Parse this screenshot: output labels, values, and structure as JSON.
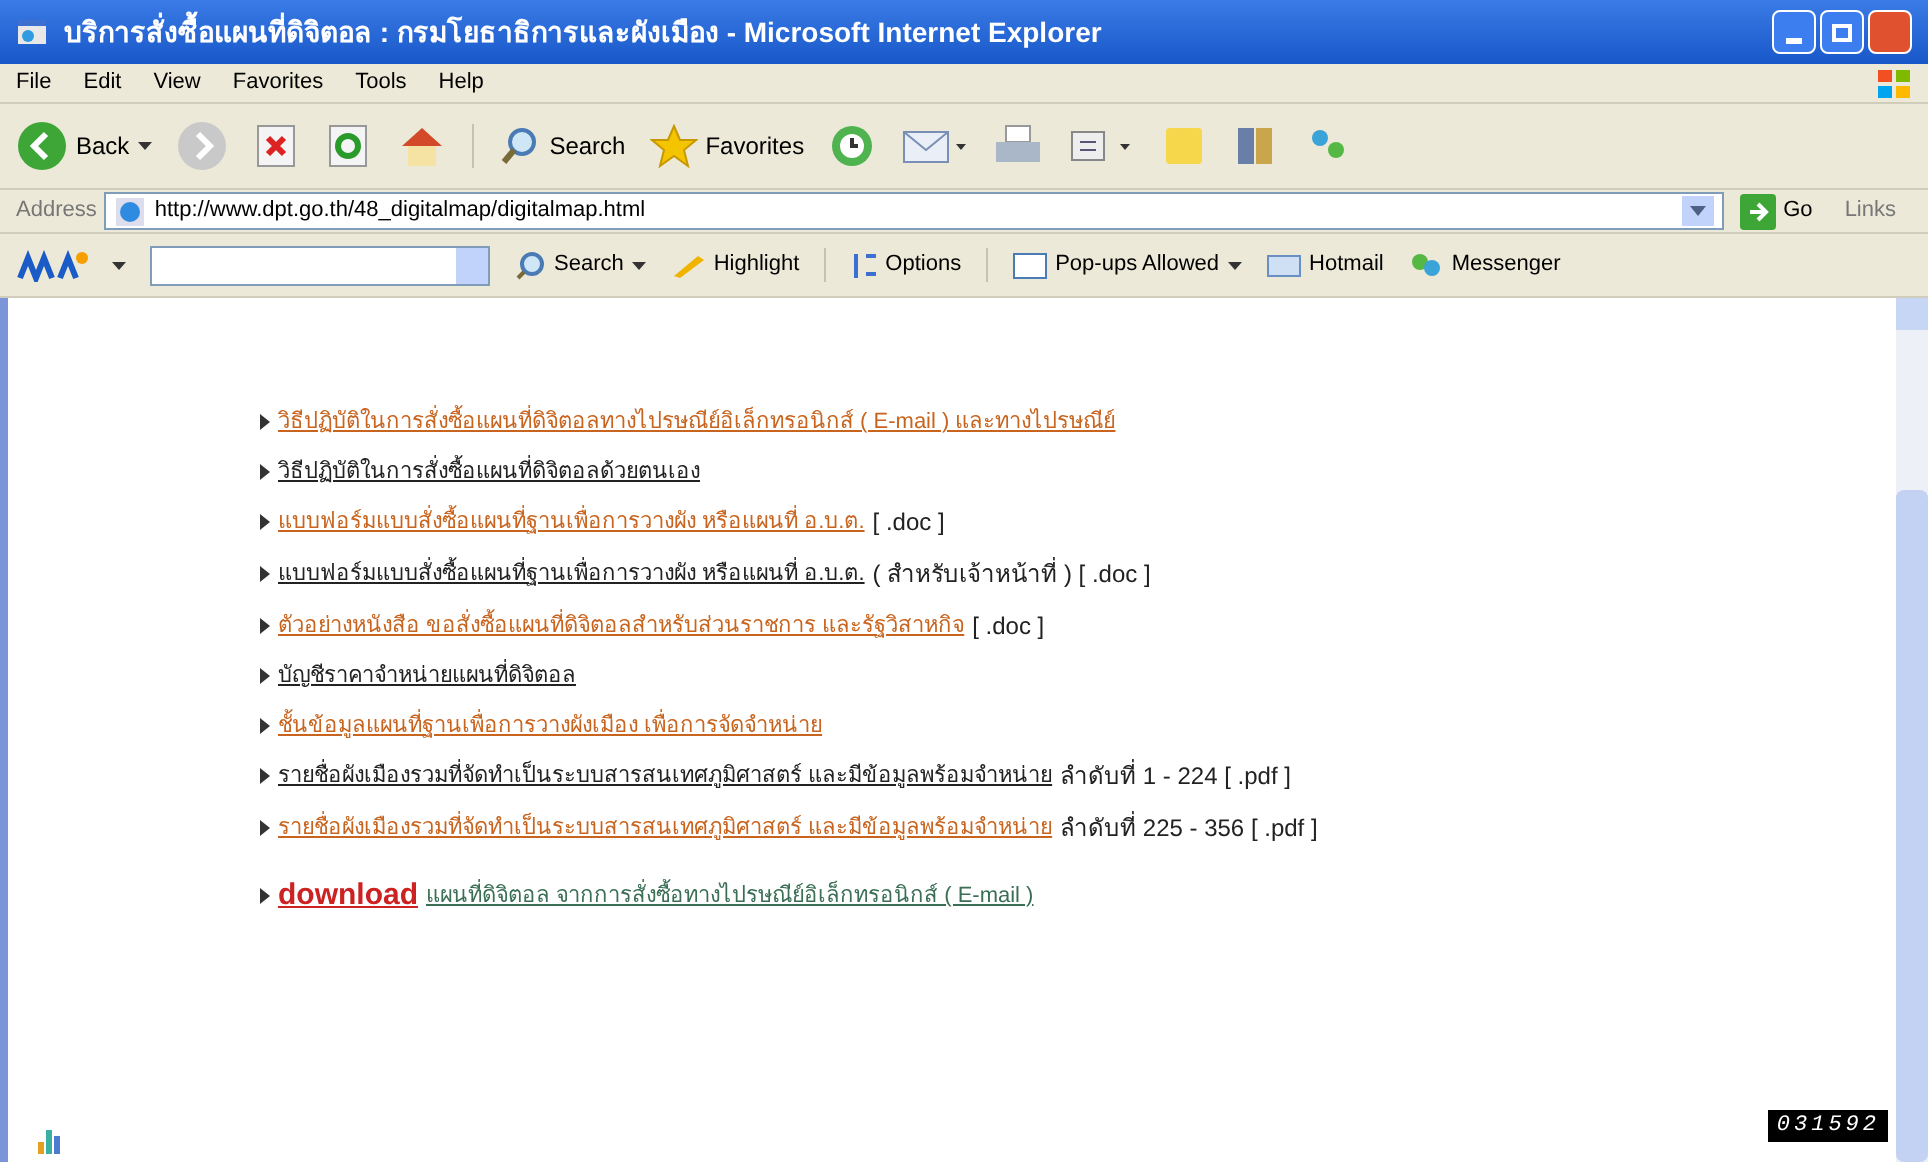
{
  "window": {
    "title": "บริการสั่งซื้อแผนที่ดิจิตอล : กรมโยธาธิการและผังเมือง - Microsoft Internet Explorer"
  },
  "menu": [
    "File",
    "Edit",
    "View",
    "Favorites",
    "Tools",
    "Help"
  ],
  "toolbar": {
    "back": "Back",
    "search": "Search",
    "favorites": "Favorites"
  },
  "address": {
    "label": "Address",
    "url": "http://www.dpt.go.th/48_digitalmap/digitalmap.html",
    "go": "Go",
    "links": "Links"
  },
  "msn_bar": {
    "search": "Search",
    "highlight": "Highlight",
    "options": "Options",
    "popups": "Pop-ups Allowed",
    "hotmail": "Hotmail",
    "messenger": "Messenger"
  },
  "links": [
    {
      "text": "วิธีปฏิบัติในการสั่งซื้อแผนที่ดิจิตอลทางไปรษณีย์อิเล็กทรอนิกส์ ( E-mail ) และทางไปรษณีย์",
      "color": "#c8641e"
    },
    {
      "text": "วิธีปฏิบัติในการสั่งซื้อแผนที่ดิจิตอลด้วยตนเอง",
      "color": "#222222"
    },
    {
      "text": "แบบฟอร์มแบบสั่งซื้อแผนที่ฐานเพื่อการวางผัง หรือแผนที่ อ.บ.ต.",
      "color": "#c8641e",
      "note": "[ .doc ]"
    },
    {
      "text": "แบบฟอร์มแบบสั่งซื้อแผนที่ฐานเพื่อการวางผัง หรือแผนที่ อ.บ.ต.",
      "color": "#222222",
      "note": "( สำหรับเจ้าหน้าที่ ) [ .doc ]"
    },
    {
      "text": "ตัวอย่างหนังสือ ขอสั่งซื้อแผนที่ดิจิตอลสำหรับส่วนราชการ และรัฐวิสาหกิจ",
      "color": "#c8641e",
      "note": "[ .doc ]"
    },
    {
      "text": "บัญชีราคาจำหน่ายแผนที่ดิจิตอล",
      "color": "#222222"
    },
    {
      "text": "ชั้นข้อมูลแผนที่ฐานเพื่อการวางผังเมือง เพื่อการจัดจำหน่าย",
      "color": "#c8641e"
    },
    {
      "text": "รายชื่อผังเมืองรวมที่จัดทำเป็นระบบสารสนเทศภูมิศาสตร์ และมีข้อมูลพร้อมจำหน่าย",
      "color": "#222222",
      "note": "ลำดับที่ 1 - 224 [ .pdf ]"
    },
    {
      "text": "รายชื่อผังเมืองรวมที่จัดทำเป็นระบบสารสนเทศภูมิศาสตร์ และมีข้อมูลพร้อมจำหน่าย",
      "color": "#c8641e",
      "note": "ลำดับที่ 225 - 356 [ .pdf ]"
    }
  ],
  "download": {
    "label": "download",
    "text": "แผนที่ดิจิตอล จากการสั่งซื้อทางไปรษณีย์อิเล็กทรอนิกส์ ( E-mail )"
  },
  "counter": "031592"
}
